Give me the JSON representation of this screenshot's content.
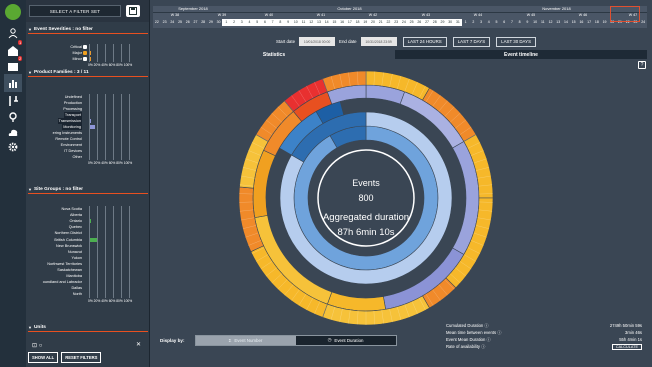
{
  "colors": {
    "sidebar_bg": "#23303c",
    "panel_bg": "#303c48",
    "main_bg": "#3a4654",
    "accent_orange": "#e85020",
    "chart_blue": "#2d6db0",
    "chart_lightblue": "#a9c9ea",
    "chart_purple": "#9aa3dc",
    "chart_yellow": "#f6b82a",
    "chart_orange": "#f08a2a",
    "chart_red": "#e83030"
  },
  "nav": {
    "icons": [
      "logo-icon",
      "person-icon",
      "alerts-icon",
      "board-icon",
      "analytics-icon",
      "tools-icon",
      "location-icon",
      "cloud-icon",
      "settings-icon"
    ]
  },
  "filters": {
    "select_label": "SELECT A FILTER SET",
    "event_severities": {
      "title": "Event Severities : no filter",
      "items": [
        {
          "label": "Critical",
          "value": 0
        },
        {
          "label": "Major",
          "value": 2
        },
        {
          "label": "Minor",
          "value": 2
        }
      ],
      "axis": "0% 20% 40% 60% 80% 100%"
    },
    "product_families": {
      "title": "Product Families : 3 / 11",
      "items": [
        {
          "label": "Undefined",
          "value": 0
        },
        {
          "label": "Production",
          "value": 0
        },
        {
          "label": "Processing",
          "value": 1
        },
        {
          "label": "Transport",
          "value": 1
        },
        {
          "label": "Transmission",
          "value": 2
        },
        {
          "label": "Monitoring",
          "value": 6
        },
        {
          "label": "ering Instruments",
          "value": 1
        },
        {
          "label": "Remote Control",
          "value": 0
        },
        {
          "label": "Environment",
          "value": 1
        },
        {
          "label": "IT Devices",
          "value": 1
        },
        {
          "label": "Other",
          "value": 0
        }
      ],
      "axis": "0% 20% 40% 60% 80% 100%"
    },
    "site_groups": {
      "title": "Site Groups : no filter",
      "items": [
        {
          "label": "Nova Scotia",
          "value": 0
        },
        {
          "label": "Alberta",
          "value": 1
        },
        {
          "label": "Ontario",
          "value": 2
        },
        {
          "label": "Quebec",
          "value": 0
        },
        {
          "label": "Northern District",
          "value": 0
        },
        {
          "label": "British Columbia",
          "value": 8
        },
        {
          "label": "New Brunswick",
          "value": 0
        },
        {
          "label": "Nunavut",
          "value": 0
        },
        {
          "label": "Yukon",
          "value": 0
        },
        {
          "label": "Northwest Territories",
          "value": 0
        },
        {
          "label": "Saskatchewan",
          "value": 0
        },
        {
          "label": "Manitoba",
          "value": 0
        },
        {
          "label": "oundland and Labrador",
          "value": 0
        },
        {
          "label": "Dallas",
          "value": 0
        },
        {
          "label": "North",
          "value": 0
        }
      ],
      "axis": "0% 20% 40% 60% 80% 100%"
    },
    "units": {
      "title": "Units"
    },
    "show_all": "SHOW ALL",
    "reset": "RESET FILTERS"
  },
  "timeline": {
    "months": [
      "September 2018",
      "October 2018",
      "November 2018"
    ],
    "weeks": [
      "W 38",
      "W 39",
      "W 40",
      "W 41",
      "W 42",
      "W 43",
      "W 44",
      "W 45",
      "W 46",
      "W 47"
    ],
    "days": [
      "22",
      "23",
      "24",
      "25",
      "26",
      "27",
      "28",
      "29",
      "30",
      "1",
      "2",
      "3",
      "4",
      "5",
      "6",
      "7",
      "8",
      "9",
      "10",
      "11",
      "12",
      "13",
      "14",
      "15",
      "16",
      "17",
      "18",
      "19",
      "20",
      "21",
      "22",
      "23",
      "24",
      "25",
      "26",
      "27",
      "28",
      "29",
      "30",
      "31",
      "1",
      "2",
      "3",
      "4",
      "5",
      "6",
      "7",
      "8",
      "9",
      "10",
      "11",
      "12",
      "13",
      "14",
      "15",
      "16",
      "17",
      "18",
      "19",
      "20",
      "21",
      "22",
      "23",
      "24"
    ]
  },
  "daterange": {
    "start_label": "Start date",
    "start_value": "10/01/2018 00:00",
    "end_label": "End date",
    "end_value": "10/31/2018 23:59",
    "btn_24h": "LAST 24 HOURS",
    "btn_7d": "LAST 7 DAYS",
    "btn_30d": "LAST 30 DAYS"
  },
  "tabs": {
    "statistics": "Statistics",
    "timeline": "Event timeline"
  },
  "center": {
    "events_label": "Events",
    "events_value": "800",
    "duration_label": "Aggregated duration",
    "duration_value": "87h 6min 10s"
  },
  "display": {
    "label": "Display by:",
    "opt1": "Event Number",
    "opt2": "Event Duration"
  },
  "stats": [
    {
      "label": "Cumulated Duration ⓘ",
      "value": "2749h 50min 59s"
    },
    {
      "label": "Mean time between events ⓘ",
      "value": "3min 46s"
    },
    {
      "label": "Event Mean Duration ⓘ",
      "value": "55h 4min 1s"
    },
    {
      "label": "Rate of availability ⓘ",
      "value": "CALCULATE"
    }
  ]
}
